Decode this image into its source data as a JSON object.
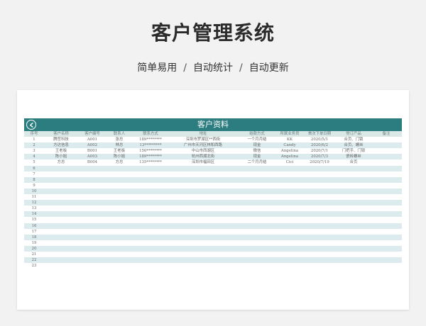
{
  "hero": {
    "title": "客户管理系统",
    "subtitle_parts": [
      "简单易用",
      "自动统计",
      "自动更新"
    ],
    "separator": "/"
  },
  "sheet": {
    "title": "客户资料",
    "columns": [
      "序号",
      "客户名称",
      "客户编号",
      "联系人",
      "联系方式",
      "地址",
      "结款方式",
      "所属业务员",
      "首次下单日期",
      "常订产品",
      "备注"
    ],
    "rows": [
      [
        "1",
        "腾哲科技",
        "A001",
        "张总",
        "189********",
        "深圳市罗湖区**西街",
        "一个月月结",
        "KK",
        "2020/5/1",
        "合页、门锁",
        ""
      ],
      [
        "2",
        "方达信息",
        "A002",
        "林总",
        "13*********",
        "广州市天河区林和西路",
        "现金",
        "Candy",
        "2020/6/2",
        "合页、螺丝",
        ""
      ],
      [
        "3",
        "王老板",
        "B001",
        "王老板",
        "156********",
        "中山市西湖区",
        "微信",
        "Angelina",
        "2020/7/1",
        "门把手、门锁",
        ""
      ],
      [
        "4",
        "陈小姐",
        "A003",
        "陈小姐",
        "189********",
        "杭州西湖北街",
        "现金",
        "Angelina",
        "2020/7/3",
        "瓷砖螺丝",
        ""
      ],
      [
        "5",
        "方总",
        "B004",
        "方总",
        "135********",
        "深圳市福田区",
        "二个月月结",
        "Cici",
        "2020/7/19",
        "合页",
        ""
      ],
      [
        "6"
      ],
      [
        "7"
      ],
      [
        "8"
      ],
      [
        "9"
      ],
      [
        "10"
      ],
      [
        "11"
      ],
      [
        "12"
      ],
      [
        "13"
      ],
      [
        "14"
      ],
      [
        "15"
      ],
      [
        "16"
      ],
      [
        "17"
      ],
      [
        "18"
      ],
      [
        "19"
      ],
      [
        "20"
      ],
      [
        "21"
      ],
      [
        "22"
      ],
      [
        "23"
      ]
    ],
    "colors": {
      "banner": "#2b7d80",
      "alt_row": "#dcebee",
      "header_row": "#dbe8e8"
    }
  }
}
